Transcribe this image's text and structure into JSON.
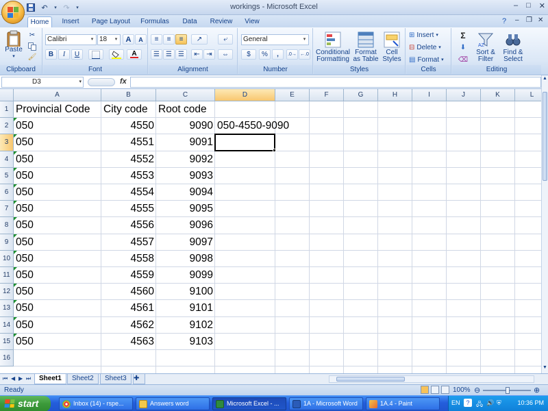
{
  "window": {
    "title": "workings - Microsoft Excel",
    "controls": [
      "–",
      "□",
      "✕"
    ]
  },
  "tabs": [
    "Home",
    "Insert",
    "Page Layout",
    "Formulas",
    "Data",
    "Review",
    "View"
  ],
  "ribbon": {
    "groups": [
      "Clipboard",
      "Font",
      "Alignment",
      "Number",
      "Styles",
      "Cells",
      "Editing"
    ],
    "clipboard": {
      "paste": "Paste"
    },
    "font": {
      "name": "Calibri",
      "size": "18",
      "bold": "B",
      "italic": "I",
      "underline": "U",
      "grow": "A",
      "shrink": "A"
    },
    "number": {
      "format": "General",
      "currency": "$",
      "percent": "%",
      "comma": ","
    },
    "styles": {
      "conditional": "Conditional\nFormatting",
      "format_table": "Format\nas Table",
      "cell_styles": "Cell\nStyles"
    },
    "cells": {
      "insert": "Insert",
      "delete": "Delete",
      "format": "Format"
    },
    "editing": {
      "sigma": "Σ",
      "sort_filter": "Sort &\nFilter",
      "find_select": "Find &\nSelect"
    }
  },
  "formula_bar": {
    "name_box": "D3",
    "fx": "fx",
    "content": ""
  },
  "columns": [
    "A",
    "B",
    "C",
    "D",
    "E",
    "F",
    "G",
    "H",
    "I",
    "J",
    "K",
    "L"
  ],
  "rows": [
    "1",
    "2",
    "3",
    "4",
    "5",
    "6",
    "7",
    "8",
    "9",
    "10",
    "11",
    "12",
    "13",
    "14",
    "15",
    "16"
  ],
  "selected": {
    "column": "D",
    "row": "3"
  },
  "cells": {
    "header": [
      "Provincial Code",
      "City code",
      "Root code"
    ],
    "data": [
      [
        "050",
        "4550",
        "9090",
        "050-4550-9090"
      ],
      [
        "050",
        "4551",
        "9091",
        ""
      ],
      [
        "050",
        "4552",
        "9092",
        ""
      ],
      [
        "050",
        "4553",
        "9093",
        ""
      ],
      [
        "050",
        "4554",
        "9094",
        ""
      ],
      [
        "050",
        "4555",
        "9095",
        ""
      ],
      [
        "050",
        "4556",
        "9096",
        ""
      ],
      [
        "050",
        "4557",
        "9097",
        ""
      ],
      [
        "050",
        "4558",
        "9098",
        ""
      ],
      [
        "050",
        "4559",
        "9099",
        ""
      ],
      [
        "050",
        "4560",
        "9100",
        ""
      ],
      [
        "050",
        "4561",
        "9101",
        ""
      ],
      [
        "050",
        "4562",
        "9102",
        ""
      ],
      [
        "050",
        "4563",
        "9103",
        ""
      ]
    ]
  },
  "sheet_tabs": [
    "Sheet1",
    "Sheet2",
    "Sheet3"
  ],
  "active_sheet": "Sheet1",
  "status": {
    "text": "Ready",
    "zoom": "100%"
  },
  "taskbar": {
    "start": "start",
    "items": [
      "Inbox (14) - rspe...",
      "Answers word",
      "Microsoft Excel - ...",
      "1A - Microsoft Word",
      "1A.4 - Paint"
    ],
    "active_item": "Microsoft Excel - ...",
    "language": "EN",
    "clock": "10:36 PM"
  },
  "colors": {
    "accent": "#15428b",
    "selected_header": "#f8c76f",
    "taskbar": "#245edc",
    "start": "#3c9a3a",
    "text_marker": "#1e8f2f"
  }
}
